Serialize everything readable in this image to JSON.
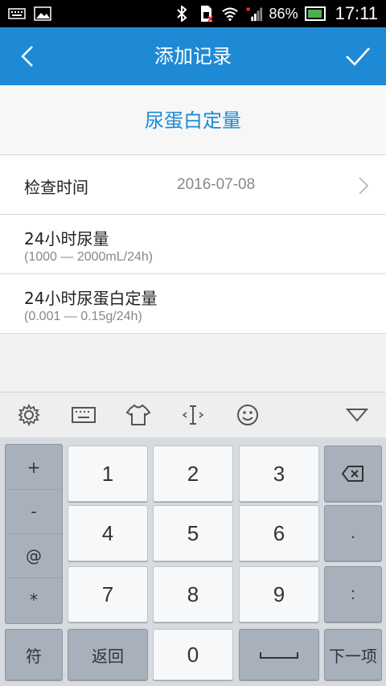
{
  "status_bar": {
    "icons_left": [
      "keyboard-icon",
      "image-icon"
    ],
    "icons_right": [
      "bluetooth-icon",
      "sim-icon",
      "wifi-icon",
      "signal-icon"
    ],
    "battery": "86%",
    "time": "17:11"
  },
  "appbar": {
    "title": "添加记录",
    "back_icon": "chevron-left-icon",
    "confirm_icon": "check-icon"
  },
  "section": {
    "title": "尿蛋白定量"
  },
  "rows": [
    {
      "label": "检查时间",
      "value": "2016-07-08"
    },
    {
      "label": "24小时尿量",
      "hint": "(1000 — 2000mL/24h)"
    },
    {
      "label": "24小时尿蛋白定量",
      "hint": "(0.001 — 0.15g/24h)"
    }
  ],
  "keyboard": {
    "toolbar": [
      "settings-icon",
      "keyboard-icon",
      "shirt-icon",
      "cursor-icon",
      "emoji-icon",
      "collapse-icon"
    ],
    "symbols": [
      "+",
      "-",
      "@",
      "*"
    ],
    "digits": [
      "1",
      "2",
      "3",
      "4",
      "5",
      "6",
      "7",
      "8",
      "9"
    ],
    "zero": "0",
    "dot": ".",
    "colon": ":",
    "symbol_switch": "符",
    "return_label": "返回",
    "space_label": "",
    "next_label": "下一项"
  },
  "colors": {
    "primary": "#1e8ad6",
    "statusbar": "#000000"
  }
}
